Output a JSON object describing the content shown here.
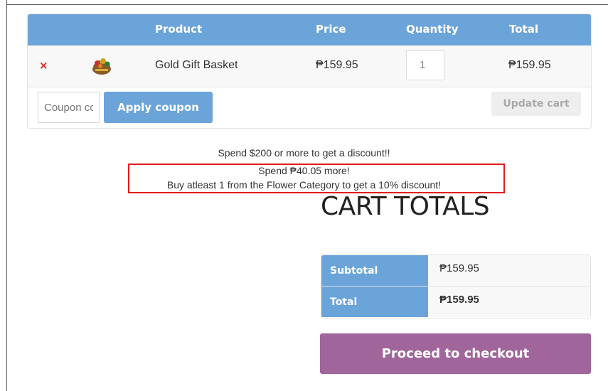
{
  "cart_table": {
    "headers": {
      "product": "Product",
      "price": "Price",
      "quantity": "Quantity",
      "total": "Total"
    },
    "rows": [
      {
        "remove_icon": "×",
        "product_name": "Gold Gift Basket",
        "price": "₱159.95",
        "quantity": "1",
        "total": "₱159.95"
      }
    ],
    "coupon_placeholder": "Coupon code",
    "apply_coupon_label": "Apply coupon",
    "update_cart_label": "Update cart"
  },
  "notices": {
    "line1": "Spend $200 or more to get a discount!!",
    "line2": "Spend ₱40.05 more!",
    "line3": "Buy atleast 1 from the Flower Category to get a 10% discount!"
  },
  "cart_totals": {
    "title": "CART TOTALS",
    "subtotal_label": "Subtotal",
    "subtotal_value": "₱159.95",
    "total_label": "Total",
    "total_value": "₱159.95"
  },
  "checkout": {
    "label": "Proceed to checkout"
  },
  "colors": {
    "accent": "#6ba4d9",
    "checkout": "#a0659b",
    "remove": "#e2211c",
    "highlight": "#e31b1b"
  }
}
